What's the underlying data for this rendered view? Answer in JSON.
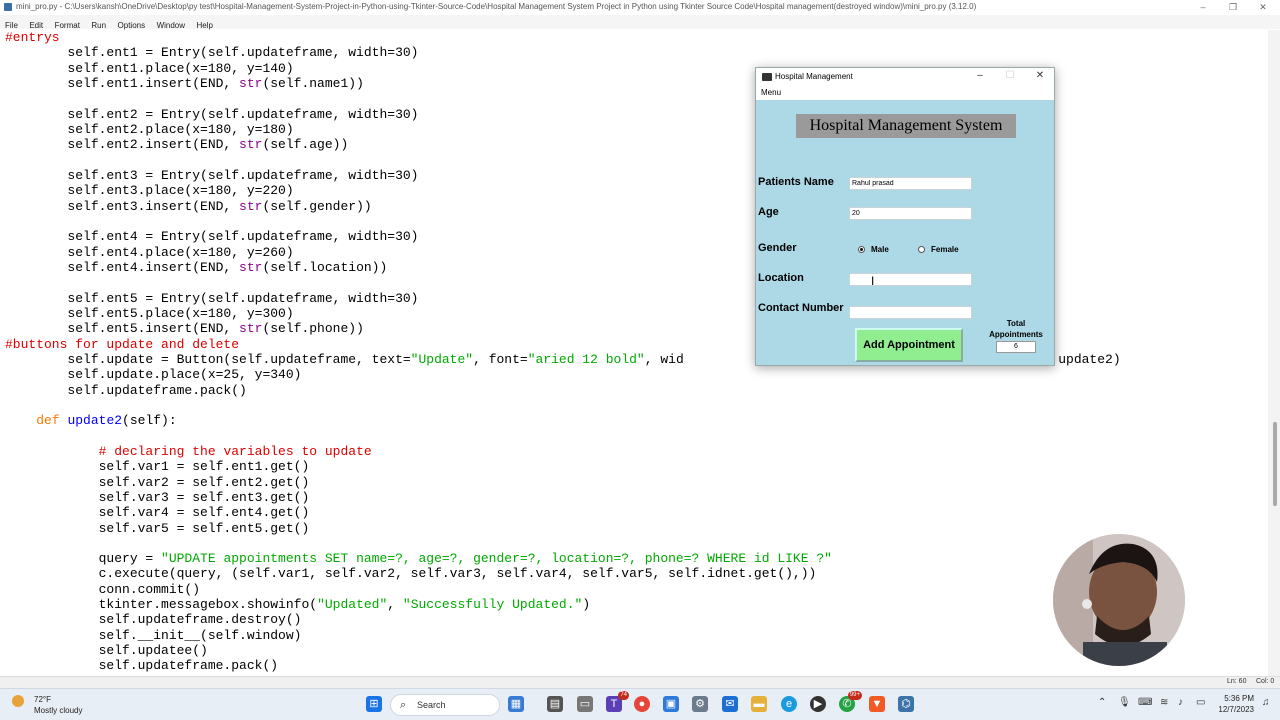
{
  "editor": {
    "title": "mini_pro.py - C:\\Users\\kansh\\OneDrive\\Desktop\\py test\\Hospital-Management-System-Project-in-Python-using-Tkinter-Source-Code\\Hospital Management System Project in Python using Tkinter Source Code\\Hospital management(destroyed window)\\mini_pro.py (3.12.0)",
    "menu": [
      "File",
      "Edit",
      "Format",
      "Run",
      "Options",
      "Window",
      "Help"
    ],
    "status_ln": "Ln: 60",
    "status_col": "Col: 0",
    "code_lines": [
      [
        {
          "t": "#entrys",
          "c": "cm"
        }
      ],
      [
        {
          "t": "        self.ent1 = Entry(self.updateframe, width=30)",
          "c": ""
        }
      ],
      [
        {
          "t": "        self.ent1.place(x=180, y=140)",
          "c": ""
        }
      ],
      [
        {
          "t": "        self.ent1.insert(END, ",
          "c": ""
        },
        {
          "t": "str",
          "c": "bi"
        },
        {
          "t": "(self.name1))",
          "c": ""
        }
      ],
      [
        {
          "t": "",
          "c": ""
        }
      ],
      [
        {
          "t": "        self.ent2 = Entry(self.updateframe, width=30)",
          "c": ""
        }
      ],
      [
        {
          "t": "        self.ent2.place(x=180, y=180)",
          "c": ""
        }
      ],
      [
        {
          "t": "        self.ent2.insert(END, ",
          "c": ""
        },
        {
          "t": "str",
          "c": "bi"
        },
        {
          "t": "(self.age))",
          "c": ""
        }
      ],
      [
        {
          "t": "",
          "c": ""
        }
      ],
      [
        {
          "t": "        self.ent3 = Entry(self.updateframe, width=30)",
          "c": ""
        }
      ],
      [
        {
          "t": "        self.ent3.place(x=180, y=220)",
          "c": ""
        }
      ],
      [
        {
          "t": "        self.ent3.insert(END, ",
          "c": ""
        },
        {
          "t": "str",
          "c": "bi"
        },
        {
          "t": "(self.gender))",
          "c": ""
        }
      ],
      [
        {
          "t": "",
          "c": ""
        }
      ],
      [
        {
          "t": "        self.ent4 = Entry(self.updateframe, width=30)",
          "c": ""
        }
      ],
      [
        {
          "t": "        self.ent4.place(x=180, y=260)",
          "c": ""
        }
      ],
      [
        {
          "t": "        self.ent4.insert(END, ",
          "c": ""
        },
        {
          "t": "str",
          "c": "bi"
        },
        {
          "t": "(self.location))",
          "c": ""
        }
      ],
      [
        {
          "t": "",
          "c": ""
        }
      ],
      [
        {
          "t": "        self.ent5 = Entry(self.updateframe, width=30)",
          "c": ""
        }
      ],
      [
        {
          "t": "        self.ent5.place(x=180, y=300)",
          "c": ""
        }
      ],
      [
        {
          "t": "        self.ent5.insert(END, ",
          "c": ""
        },
        {
          "t": "str",
          "c": "bi"
        },
        {
          "t": "(self.phone))",
          "c": ""
        }
      ],
      [
        {
          "t": "#buttons for update and delete",
          "c": "cm"
        }
      ],
      [
        {
          "t": "        self.update = Button(self.updateframe, text=",
          "c": ""
        },
        {
          "t": "\"Update\"",
          "c": "str"
        },
        {
          "t": ", font=",
          "c": ""
        },
        {
          "t": "\"aried 12 bold\"",
          "c": "str"
        },
        {
          "t": ", wid",
          "c": ""
        },
        {
          "t": "                                    ",
          "c": ""
        },
        {
          "t": "ommand=self.update2)",
          "c": ""
        }
      ],
      [
        {
          "t": "        self.update.place(x=25, y=340)",
          "c": ""
        }
      ],
      [
        {
          "t": "        self.updateframe.pack()",
          "c": ""
        }
      ],
      [
        {
          "t": "",
          "c": ""
        }
      ],
      [
        {
          "t": "    ",
          "c": ""
        },
        {
          "t": "def",
          "c": "kw"
        },
        {
          "t": " ",
          "c": ""
        },
        {
          "t": "update2",
          "c": "fn"
        },
        {
          "t": "(self):",
          "c": ""
        }
      ],
      [
        {
          "t": "",
          "c": ""
        }
      ],
      [
        {
          "t": "            ",
          "c": ""
        },
        {
          "t": "# declaring the variables to update",
          "c": "cm"
        }
      ],
      [
        {
          "t": "            self.var1 = self.ent1.get()",
          "c": ""
        }
      ],
      [
        {
          "t": "            self.var2 = self.ent2.get()",
          "c": ""
        }
      ],
      [
        {
          "t": "            self.var3 = self.ent3.get()",
          "c": ""
        }
      ],
      [
        {
          "t": "            self.var4 = self.ent4.get()",
          "c": ""
        }
      ],
      [
        {
          "t": "            self.var5 = self.ent5.get()",
          "c": ""
        }
      ],
      [
        {
          "t": "",
          "c": ""
        }
      ],
      [
        {
          "t": "            query = ",
          "c": ""
        },
        {
          "t": "\"UPDATE appointments SET name=?, age=?, gender=?, location=?, phone=? WHERE id LIKE ?\"",
          "c": "str"
        }
      ],
      [
        {
          "t": "            c.execute(query, (self.var1, self.var2, self.var3, self.var4, self.var5, self.idnet.get(),))",
          "c": ""
        }
      ],
      [
        {
          "t": "            conn.commit()",
          "c": ""
        }
      ],
      [
        {
          "t": "            tkinter.messagebox.showinfo(",
          "c": ""
        },
        {
          "t": "\"Updated\"",
          "c": "str"
        },
        {
          "t": ", ",
          "c": ""
        },
        {
          "t": "\"Successfully Updated.\"",
          "c": "str"
        },
        {
          "t": ")",
          "c": ""
        }
      ],
      [
        {
          "t": "            self.updateframe.destroy()",
          "c": ""
        }
      ],
      [
        {
          "t": "            self.__init__(self.window)",
          "c": ""
        }
      ],
      [
        {
          "t": "            self.updatee()",
          "c": ""
        }
      ],
      [
        {
          "t": "            self.updateframe.pack()",
          "c": ""
        }
      ]
    ]
  },
  "tk_window": {
    "title": "Hospital Management",
    "menu": "Menu",
    "heading": "Hospital Management System",
    "fields": {
      "patients_name_label": "Patients Name",
      "patients_name_value": "Rahul prasad",
      "age_label": "Age",
      "age_value": "20",
      "gender_label": "Gender",
      "gender_male": "Male",
      "gender_female": "Female",
      "gender_selected": "Male",
      "location_label": "Location",
      "location_value": "",
      "contact_label": "Contact Number",
      "contact_value": ""
    },
    "add_button": "Add Appointment",
    "total_label_1": "Total",
    "total_label_2": "Appointments",
    "total_value": "6",
    "colors": {
      "background": "#add8e6",
      "button": "#90ee90",
      "heading_bg": "#9a9a9a"
    }
  },
  "taskbar": {
    "weather_temp": "72°F",
    "weather_desc": "Mostly cloudy",
    "search_label": "Search",
    "badge_a": "74",
    "badge_b": "99+",
    "time": "5:36 PM",
    "date": "12/7/2023",
    "icons": [
      "start-icon",
      "search-icon",
      "widgets-icon",
      "files-icon",
      "photos-icon",
      "chrome-icon",
      "store-icon",
      "settings-icon",
      "mail-icon",
      "explorer-icon",
      "edge-icon",
      "media-icon",
      "whatsapp-icon",
      "brave-icon",
      "python-icon"
    ]
  }
}
